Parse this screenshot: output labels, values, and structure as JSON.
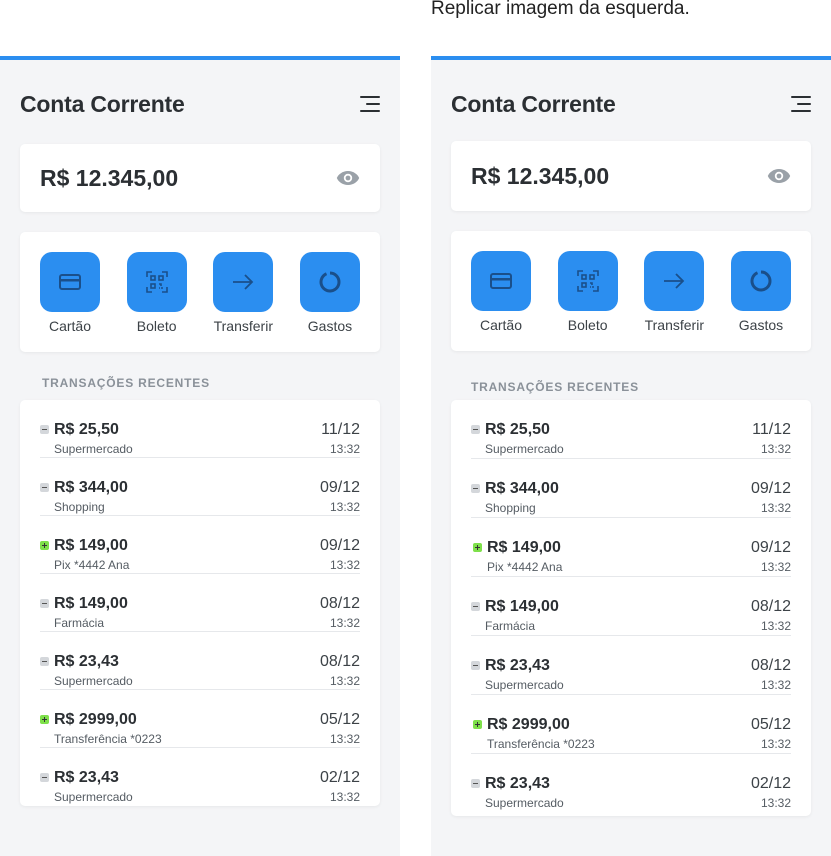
{
  "caption": "Replicar imagem da esquerda.",
  "accent_color": "#2b8ef0",
  "header": {
    "title": "Conta Corrente",
    "menu_icon": "hamburger-menu-icon"
  },
  "balance": {
    "amount": "R$ 12.345,00",
    "visibility_icon": "eye-icon"
  },
  "actions": [
    {
      "label": "Cartão",
      "icon": "credit-card-icon"
    },
    {
      "label": "Boleto",
      "icon": "barcode-scan-icon"
    },
    {
      "label": "Transferir",
      "icon": "arrow-right-icon"
    },
    {
      "label": "Gastos",
      "icon": "donut-chart-icon"
    }
  ],
  "transactions_title": "TRANSAÇÕES RECENTES",
  "transactions": [
    {
      "type": "debit",
      "amount": "R$ 25,50",
      "description": "Supermercado",
      "date": "11/12",
      "time": "13:32"
    },
    {
      "type": "debit",
      "amount": "R$ 344,00",
      "description": "Shopping",
      "date": "09/12",
      "time": "13:32"
    },
    {
      "type": "credit",
      "amount": "R$ 149,00",
      "description": "Pix *4442 Ana",
      "date": "09/12",
      "time": "13:32"
    },
    {
      "type": "debit",
      "amount": "R$ 149,00",
      "description": "Farmácia",
      "date": "08/12",
      "time": "13:32"
    },
    {
      "type": "debit",
      "amount": "R$ 23,43",
      "description": "Supermercado",
      "date": "08/12",
      "time": "13:32"
    },
    {
      "type": "credit",
      "amount": "R$ 2999,00",
      "description": "Transferência *0223",
      "date": "05/12",
      "time": "13:32"
    },
    {
      "type": "debit",
      "amount": "R$ 23,43",
      "description": "Supermercado",
      "date": "02/12",
      "time": "13:32"
    }
  ]
}
